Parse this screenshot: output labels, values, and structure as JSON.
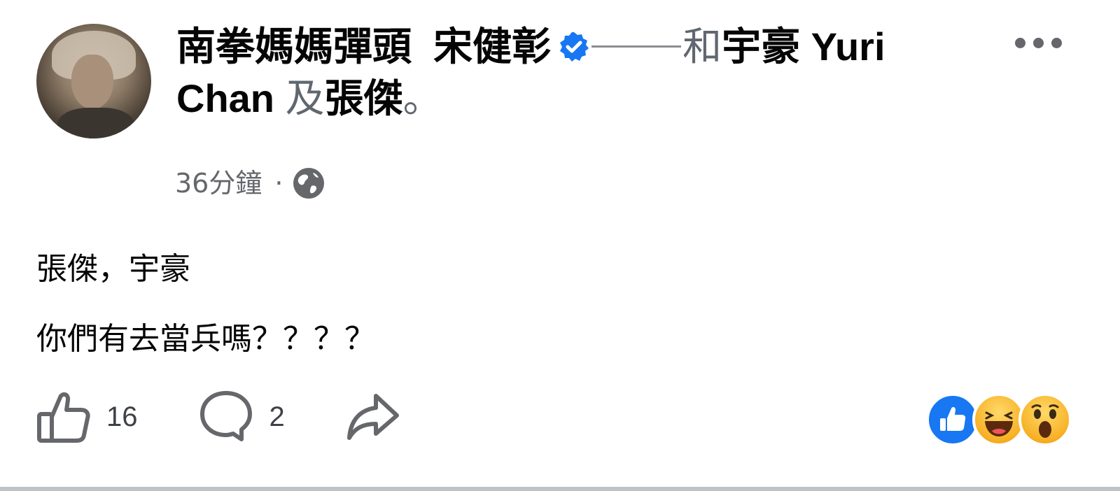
{
  "post": {
    "header": {
      "group_name": "南拳媽媽彈頭",
      "author": "宋健彰",
      "connector_word": "和",
      "tagged_1_part1": "宇豪 Yuri",
      "tagged_1_part2": "Chan",
      "and_word": "及",
      "tagged_2": "張傑",
      "end_punct": "。"
    },
    "timestamp": "36分鐘",
    "separator": "·",
    "privacy_icon": "globe-icon",
    "body_lines": [
      "張傑，宇豪",
      "你們有去當兵嗎？？？？"
    ],
    "actions": {
      "like_count": "16",
      "comment_count": "2"
    },
    "reactions": [
      "like-reaction-icon",
      "haha-reaction-icon",
      "wow-reaction-icon"
    ],
    "colors": {
      "verified": "#1877f2",
      "like_reaction": "#1877f2",
      "text": "#050505",
      "meta": "#65676b"
    }
  }
}
